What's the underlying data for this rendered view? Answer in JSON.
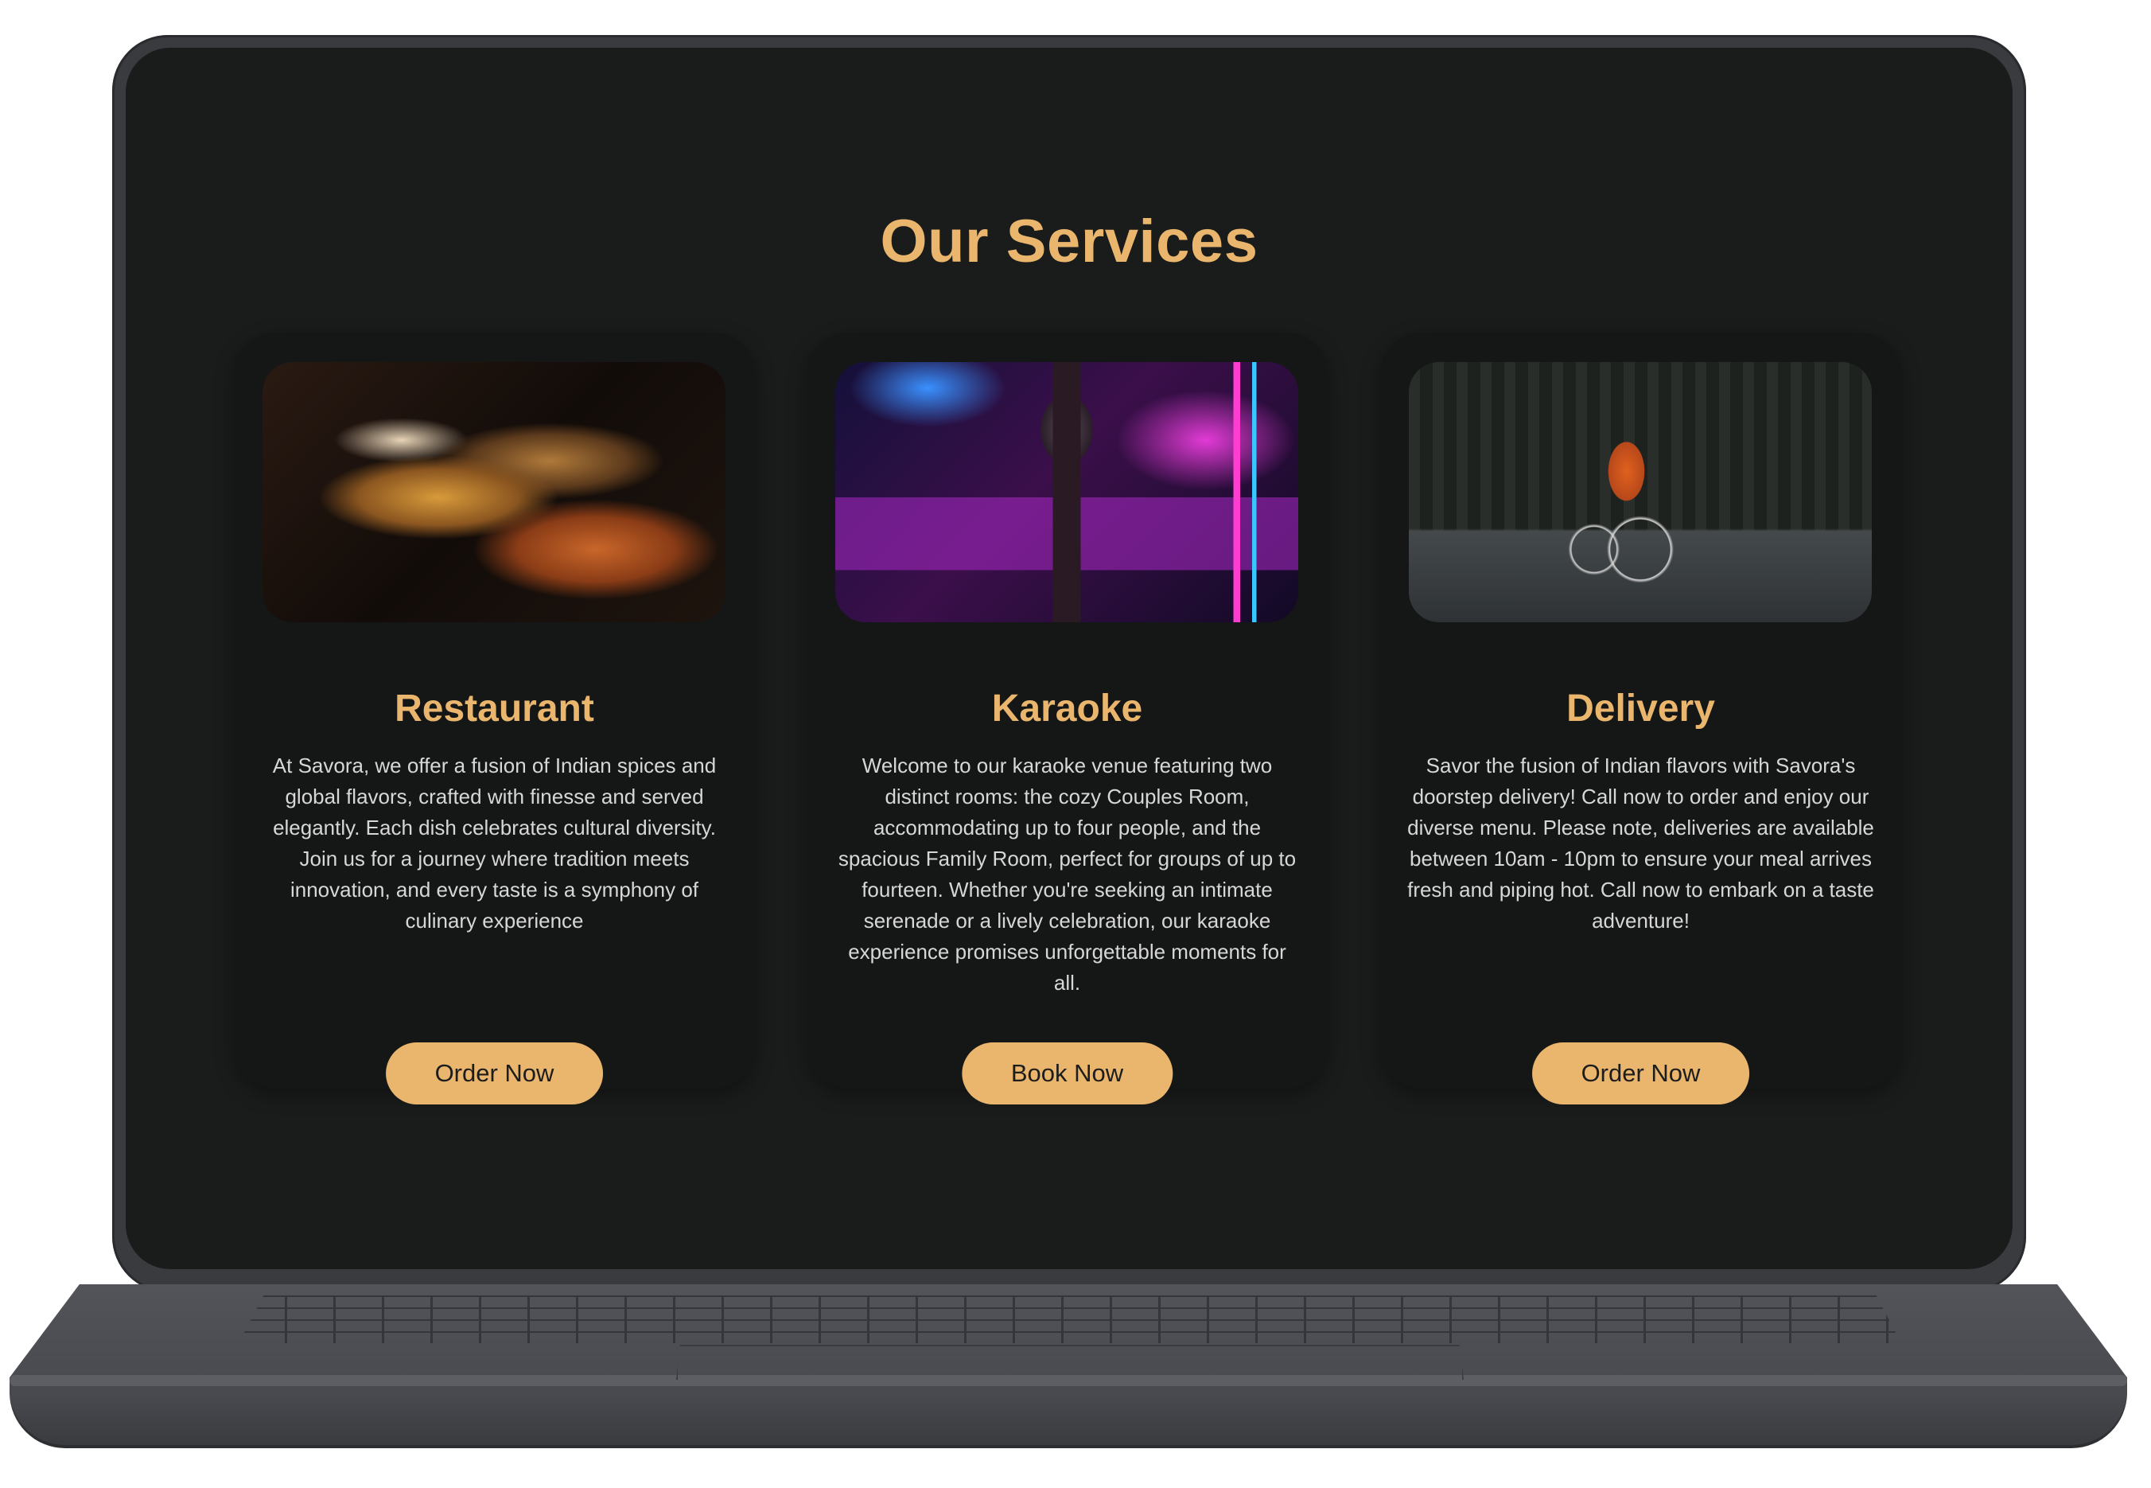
{
  "section": {
    "title": "Our Services"
  },
  "cards": [
    {
      "title": "Restaurant",
      "description": "At Savora, we offer a fusion of Indian spices and global flavors, crafted with finesse and served elegantly. Each dish celebrates cultural diversity. Join us for a journey where tradition meets innovation, and every taste is a symphony of culinary experience",
      "button": "Order Now",
      "image": "restaurant-buffet-photo"
    },
    {
      "title": "Karaoke",
      "description": "Welcome to our karaoke venue featuring two distinct rooms: the cozy Couples Room, accommodating up to four people, and the spacious Family Room, perfect for groups of up to fourteen. Whether you're seeking an intimate serenade or a lively celebration, our karaoke experience promises unforgettable moments for all.",
      "button": "Book Now",
      "image": "karaoke-room-microphone-photo"
    },
    {
      "title": "Delivery",
      "description": "Savor the fusion of Indian flavors with Savora's doorstep delivery! Call now to order and enjoy our diverse menu. Please note, deliveries are available between 10am - 10pm to ensure your meal arrives fresh and piping hot. Call now to embark on a taste adventure!",
      "button": "Order Now",
      "image": "delivery-cyclist-photo"
    }
  ],
  "colors": {
    "accent": "#eab66d",
    "background": "#1a1b1b",
    "card": "#151616",
    "text": "#d7d7d7"
  }
}
